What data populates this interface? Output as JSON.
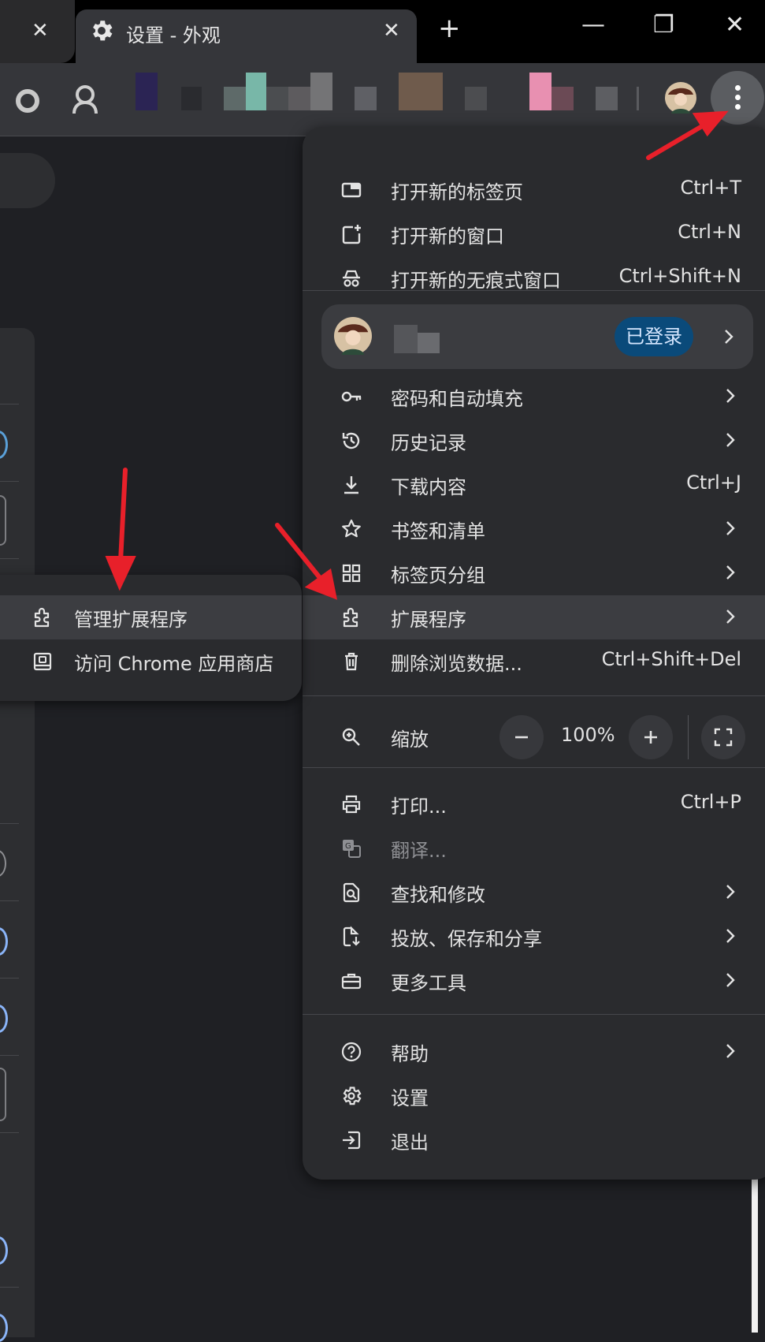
{
  "window": {
    "tab_title": "设置 - 外观",
    "prev_tab_close": "✕",
    "active_tab_close": "✕",
    "new_tab": "+",
    "minimize": "—",
    "restore": "❐",
    "close": "✕"
  },
  "menu": {
    "items_top": [
      {
        "label": "打开新的标签页",
        "shortcut": "Ctrl+T"
      },
      {
        "label": "打开新的窗口",
        "shortcut": "Ctrl+N"
      },
      {
        "label": "打开新的无痕式窗口",
        "shortcut": "Ctrl+Shift+N"
      }
    ],
    "profile": {
      "status": "已登录"
    },
    "items_mid": [
      {
        "label": "密码和自动填充",
        "shortcut": ""
      },
      {
        "label": "历史记录",
        "shortcut": ""
      },
      {
        "label": "下载内容",
        "shortcut": "Ctrl+J"
      },
      {
        "label": "书签和清单",
        "shortcut": ""
      },
      {
        "label": "标签页分组",
        "shortcut": ""
      },
      {
        "label": "扩展程序",
        "shortcut": ""
      },
      {
        "label": "删除浏览数据...",
        "shortcut": "Ctrl+Shift+Del"
      }
    ],
    "zoom": {
      "label": "缩放",
      "value": "100%",
      "minus": "−",
      "plus": "+"
    },
    "items_tools": [
      {
        "label": "打印...",
        "shortcut": "Ctrl+P"
      },
      {
        "label": "翻译...",
        "shortcut": ""
      },
      {
        "label": "查找和修改",
        "shortcut": ""
      },
      {
        "label": "投放、保存和分享",
        "shortcut": ""
      },
      {
        "label": "更多工具",
        "shortcut": ""
      }
    ],
    "items_bottom": [
      {
        "label": "帮助"
      },
      {
        "label": "设置"
      },
      {
        "label": "退出"
      }
    ]
  },
  "submenu": {
    "items": [
      {
        "label": "管理扩展程序"
      },
      {
        "label": "访问 Chrome 应用商店"
      }
    ]
  },
  "colors": {
    "annotation_arrow": "#e8202a",
    "signed_in_badge": "#0a4a7a"
  }
}
